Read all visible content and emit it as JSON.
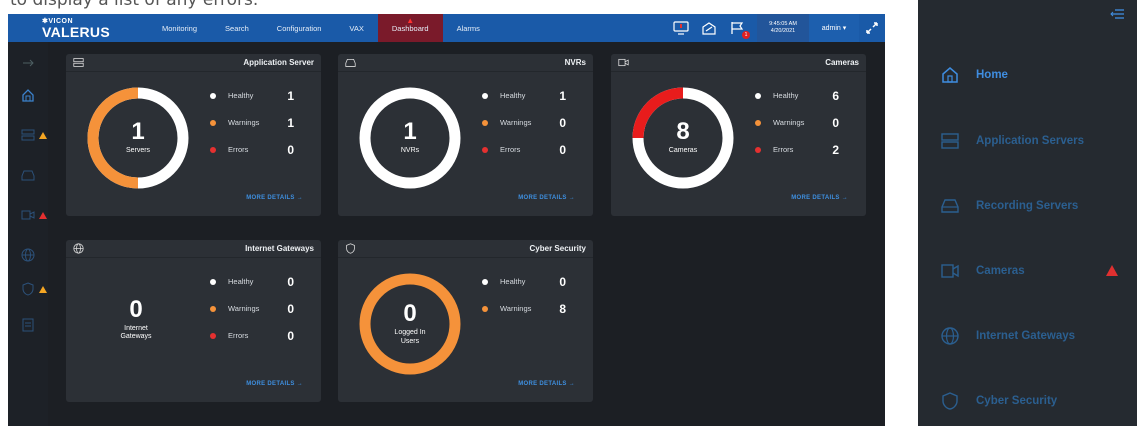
{
  "caption_text": "to display a list of any errors.",
  "topbar": {
    "brand_sub": "✱VICON",
    "brand_main": "VALERUS",
    "nav": [
      "Monitoring",
      "Search",
      "Configuration",
      "VAX",
      "Dashboard",
      "Alarms"
    ],
    "active_nav": "Dashboard",
    "flag_count": "1",
    "time": "9:45:05 AM",
    "date": "4/20/2021",
    "user": "admin ▾"
  },
  "cards": {
    "app_server": {
      "title": "Application Server",
      "count": "1",
      "count_label": "Servers",
      "stats": [
        {
          "label": "Healthy",
          "value": "1",
          "color": "#ffffff"
        },
        {
          "label": "Warnings",
          "value": "1",
          "color": "#f5923a"
        },
        {
          "label": "Errors",
          "value": "0",
          "color": "#e53030"
        }
      ],
      "more": "MORE DETAILS →"
    },
    "nvrs": {
      "title": "NVRs",
      "count": "1",
      "count_label": "NVRs",
      "stats": [
        {
          "label": "Healthy",
          "value": "1",
          "color": "#ffffff"
        },
        {
          "label": "Warnings",
          "value": "0",
          "color": "#f5923a"
        },
        {
          "label": "Errors",
          "value": "0",
          "color": "#e53030"
        }
      ],
      "more": "MORE DETAILS →"
    },
    "cameras": {
      "title": "Cameras",
      "count": "8",
      "count_label": "Cameras",
      "stats": [
        {
          "label": "Healthy",
          "value": "6",
          "color": "#ffffff"
        },
        {
          "label": "Warnings",
          "value": "0",
          "color": "#f5923a"
        },
        {
          "label": "Errors",
          "value": "2",
          "color": "#e53030"
        }
      ],
      "more": "MORE DETAILS →"
    },
    "gateways": {
      "title": "Internet Gateways",
      "count": "0",
      "count_label": "Internet Gateways",
      "stats": [
        {
          "label": "Healthy",
          "value": "0",
          "color": "#ffffff"
        },
        {
          "label": "Warnings",
          "value": "0",
          "color": "#f5923a"
        },
        {
          "label": "Errors",
          "value": "0",
          "color": "#e53030"
        }
      ],
      "more": "MORE DETAILS →"
    },
    "cyber": {
      "title": "Cyber Security",
      "count": "0",
      "count_label": "Logged In Users",
      "stats": [
        {
          "label": "Healthy",
          "value": "0",
          "color": "#ffffff"
        },
        {
          "label": "Warnings",
          "value": "8",
          "color": "#f5923a"
        }
      ],
      "more": "MORE DETAILS →"
    }
  },
  "panel": {
    "items": [
      {
        "label": "Home",
        "icon": "home-icon",
        "active": true
      },
      {
        "label": "Application Servers",
        "icon": "server-icon"
      },
      {
        "label": "Recording Servers",
        "icon": "hdd-icon"
      },
      {
        "label": "Cameras",
        "icon": "camera-icon",
        "warning": true
      },
      {
        "label": "Internet Gateways",
        "icon": "globe-icon"
      },
      {
        "label": "Cyber Security",
        "icon": "shield-icon"
      }
    ]
  },
  "colors": {
    "ok_ring": "#ffffff",
    "warn_ring": "#f5923a",
    "error_ring": "#e81c1c",
    "accent": "#3f8de0",
    "topbar": "#1a5aa8"
  }
}
